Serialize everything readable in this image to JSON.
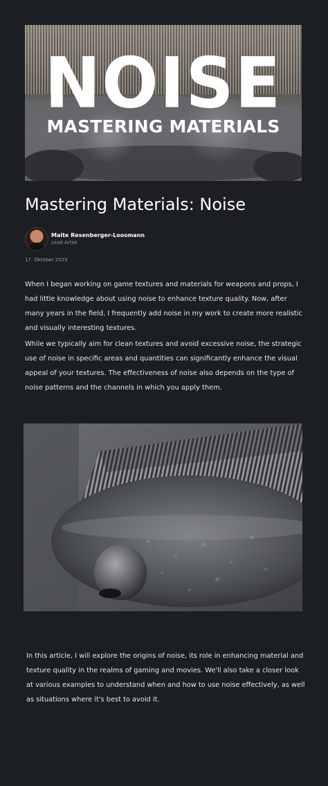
{
  "hero": {
    "title": "NOISE",
    "subtitle": "MASTERING MATERIALS"
  },
  "article": {
    "title": "Mastering Materials: Noise",
    "author_name": "Malte Resenberger-Loosmann",
    "author_role": "Lead Artist",
    "date": "17. Oktober 2023",
    "paragraphs": [
      "When I began working on game textures and materials for weapons and props, I had little knowledge about using noise to enhance texture quality. Now, after many years in the field, I frequently add noise in my work to create more realistic and visually interesting textures.",
      "While we typically aim for clean textures and avoid excessive noise, the strategic use of noise in specific areas and quantities can significantly enhance the visual appeal of your textures. The effectiveness of noise also depends on the type of noise patterns and the channels in which you apply them.",
      "In this article, I will explore the origins of noise, its role in enhancing material and texture quality in the realms of gaming and movies. We'll also take a closer look at various examples to understand when and how to use noise effectively, as well as situations where it's best to avoid it."
    ]
  },
  "colors": {
    "background": "#1b1e23",
    "text": "#e6e8eb",
    "muted": "#9aa0a6"
  }
}
